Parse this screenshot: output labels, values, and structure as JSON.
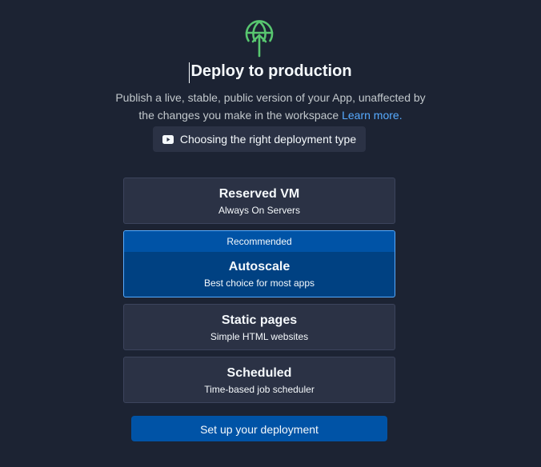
{
  "header": {
    "logo_icon": "globe-upload-icon",
    "title": "Deploy to production",
    "description_line1": "Publish a live, stable, public version of your App, unaffected by",
    "description_line2": "the changes you make in the workspace",
    "learn_more": "Learn more.",
    "video_label": "Choosing the right deployment type",
    "video_icon": "youtube-icon"
  },
  "options": {
    "reserved": {
      "name": "Reserved VM",
      "sub": "Always On Servers"
    },
    "autoscale": {
      "badge": "Recommended",
      "name": "Autoscale",
      "sub": "Best choice for most apps"
    },
    "static": {
      "name": "Static pages",
      "sub": "Simple HTML websites"
    },
    "scheduled": {
      "name": "Scheduled",
      "sub": "Time-based job scheduler"
    }
  },
  "cta": {
    "label": "Set up your deployment"
  },
  "colors": {
    "background": "#1c2333",
    "card": "#2b3245",
    "selected": "#004182",
    "accent": "#0053a6",
    "logo": "#58c770",
    "link": "#57abff"
  }
}
